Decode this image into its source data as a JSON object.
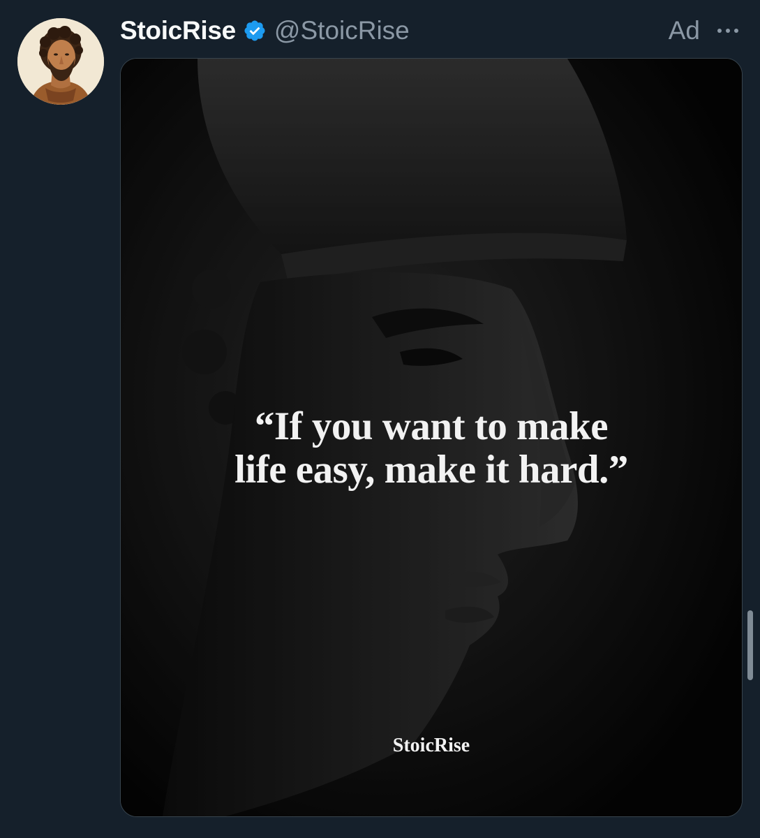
{
  "post": {
    "display_name": "StoicRise",
    "handle": "@StoicRise",
    "ad_label": "Ad",
    "verified_icon": "verified-badge-icon",
    "more_icon": "more-horizontal-icon",
    "avatar_description_icon": "avatar-bust-icon"
  },
  "media": {
    "quote_lines": [
      "“If you want to make",
      "life easy, make it hard.”"
    ],
    "brand": "StoicRise"
  },
  "colors": {
    "background": "#15202b",
    "text_primary": "#f7f9f9",
    "text_secondary": "#8b98a5",
    "verified": "#1d9bf0"
  }
}
